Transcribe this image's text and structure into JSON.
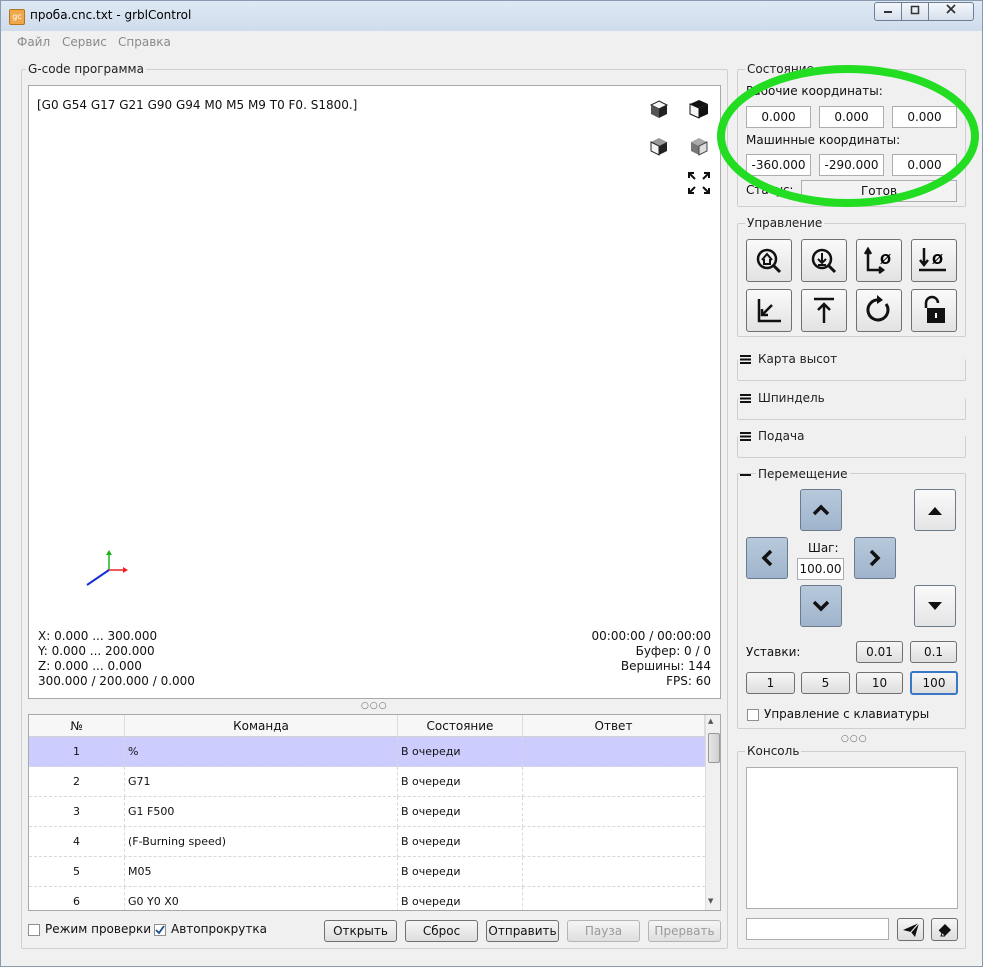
{
  "window": {
    "title": "проба.cnc.txt - grblControl"
  },
  "menu": [
    "Файл",
    "Сервис",
    "Справка"
  ],
  "gcode": {
    "group_title": "G-code программа",
    "state_line": "[G0 G54 G17 G21 G90 G94 M0 M5 M9 T0 F0. S1800.]",
    "info_left": [
      "X: 0.000 ... 300.000",
      "Y: 0.000 ... 200.000",
      "Z: 0.000 ... 0.000",
      "300.000 / 200.000 / 0.000"
    ],
    "info_right": [
      "00:00:00 / 00:00:00",
      "Буфер: 0 / 0",
      "Вершины: 144",
      "FPS: 60"
    ],
    "splitter": "○○○"
  },
  "table": {
    "headers": [
      "№",
      "Команда",
      "Состояние",
      "Ответ"
    ],
    "rows": [
      {
        "num": "1",
        "cmd": "%",
        "state": "В очереди",
        "resp": ""
      },
      {
        "num": "2",
        "cmd": "G71",
        "state": "В очереди",
        "resp": ""
      },
      {
        "num": "3",
        "cmd": "G1 F500",
        "state": "В очереди",
        "resp": ""
      },
      {
        "num": "4",
        "cmd": "(F-Burning speed)",
        "state": "В очереди",
        "resp": ""
      },
      {
        "num": "5",
        "cmd": "M05",
        "state": "В очереди",
        "resp": ""
      },
      {
        "num": "6",
        "cmd": "G0 Y0 X0",
        "state": "В очереди",
        "resp": ""
      }
    ]
  },
  "bottom": {
    "check_mode": "Режим проверки",
    "autoscroll": "Автопрокрутка",
    "buttons": [
      "Открыть",
      "Сброс",
      "Отправить",
      "Пауза",
      "Прервать"
    ]
  },
  "status": {
    "title": "Состояние",
    "work_label": "Рабочие координаты:",
    "work": [
      "0.000",
      "0.000",
      "0.000"
    ],
    "machine_label": "Машинные координаты:",
    "machine": [
      "-360.000",
      "-290.000",
      "0.000"
    ],
    "status_label": "Статус:",
    "status_value": "Готов"
  },
  "control": {
    "title": "Управление"
  },
  "sections": {
    "heightmap": "Карта высот",
    "spindle": "Шпиндель",
    "feed": "Подача",
    "jog": "Перемещение"
  },
  "jog": {
    "step_label": "Шаг:",
    "step_value": "100.00",
    "presets_label": "Уставки:",
    "presets_top": [
      "0.01",
      "0.1"
    ],
    "presets_bottom": [
      "1",
      "5",
      "10",
      "100"
    ],
    "keyboard": "Управление с клавиатуры",
    "splitter": "○○○"
  },
  "console": {
    "title": "Консоль"
  },
  "colors": {
    "highlight_ring": "#22dd22",
    "selected_row": "#ccccff",
    "jog_blue": "#a9bdd3"
  }
}
